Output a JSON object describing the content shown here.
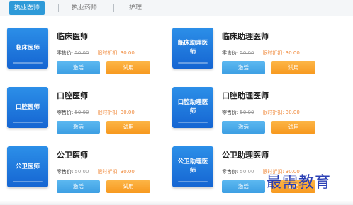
{
  "tabs": [
    {
      "label": "执业医师",
      "active": true
    },
    {
      "label": "执业药师",
      "active": false
    },
    {
      "label": "护理",
      "active": false
    }
  ],
  "price_labels": {
    "retail": "零售价:",
    "discount": "限时折扣:"
  },
  "buttons": {
    "activate": "激活",
    "trial": "试用"
  },
  "courses": [
    {
      "cover": "临床医师",
      "title": "临床医师",
      "retail_price": "50.00",
      "discount_price": "30.00"
    },
    {
      "cover": "临床助理医师",
      "title": "临床助理医师",
      "retail_price": "50.00",
      "discount_price": "30.00"
    },
    {
      "cover": "口腔医师",
      "title": "口腔医师",
      "retail_price": "50.00",
      "discount_price": "30.00"
    },
    {
      "cover": "口腔助理医师",
      "title": "口腔助理医师",
      "retail_price": "50.00",
      "discount_price": "30.00"
    },
    {
      "cover": "公卫医师",
      "title": "公卫医师",
      "retail_price": "50.00",
      "discount_price": "30.00"
    },
    {
      "cover": "公卫助理医师",
      "title": "公卫助理医师",
      "retail_price": "50.00",
      "discount_price": "30.00"
    }
  ],
  "watermark": "最需教育",
  "colors": {
    "tab_active": "#2e9ad8",
    "cover_blue": "#1e7ae0",
    "activate_button": "#4aa9e8",
    "trial_button": "#f9a531",
    "discount_text": "#f08a3c",
    "watermark": "#2a3fb5"
  }
}
